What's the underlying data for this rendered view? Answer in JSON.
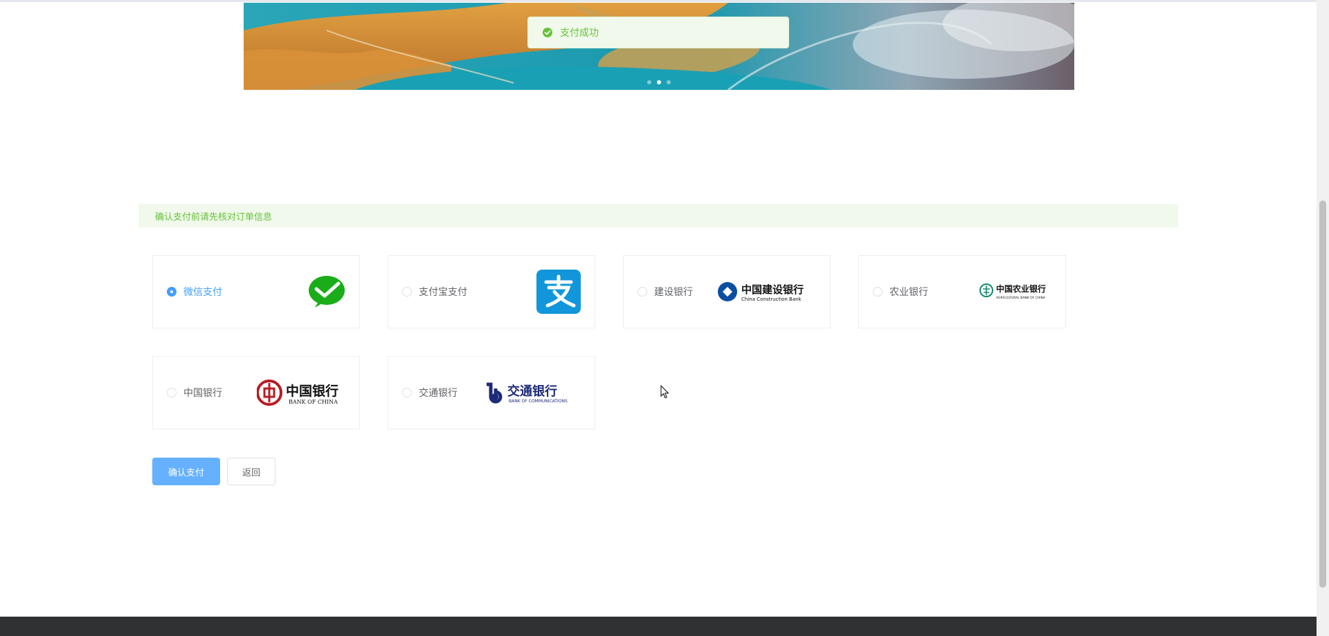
{
  "toast": {
    "icon": "check-circle-icon",
    "text": "支付成功",
    "color": "#67c23a"
  },
  "carousel": {
    "slide_count": 3,
    "active_index": 1
  },
  "alert": {
    "text": "确认支付前请先核对订单信息"
  },
  "payment_methods": [
    {
      "label": "微信支付",
      "checked": true,
      "logo": "wechat-pay-logo"
    },
    {
      "label": "支付宝支付",
      "checked": false,
      "logo": "alipay-logo"
    },
    {
      "label": "建设银行",
      "checked": false,
      "logo": "ccb-logo",
      "logo_text": "中国建设银行",
      "logo_sub": "China Construction Bank"
    },
    {
      "label": "农业银行",
      "checked": false,
      "logo": "abc-logo",
      "logo_text": "中国农业银行",
      "logo_sub": "AGRICULTURAL BANK OF CHINA"
    },
    {
      "label": "中国银行",
      "checked": false,
      "logo": "boc-logo",
      "logo_text": "中国银行",
      "logo_sub": "BANK OF CHINA"
    },
    {
      "label": "交通银行",
      "checked": false,
      "logo": "bocom-logo",
      "logo_text": "交通银行",
      "logo_sub": "BANK OF COMMUNICATIONS"
    }
  ],
  "actions": {
    "confirm_label": "确认支付",
    "back_label": "返回"
  },
  "colors": {
    "primary": "#409eff",
    "primary_light": "#66b1ff",
    "success": "#67c23a",
    "success_bg": "#f0f9eb"
  }
}
